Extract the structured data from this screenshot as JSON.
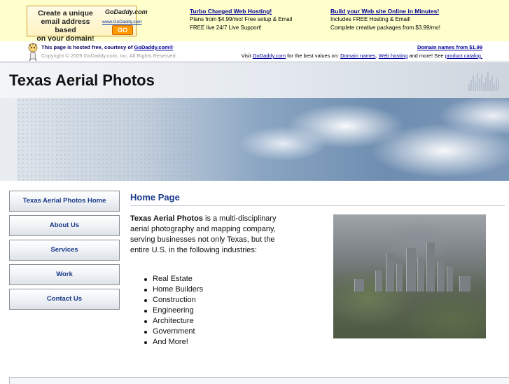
{
  "ad_banner": {
    "ad_box": {
      "text_lines": [
        "Create a unique",
        "email address based",
        "on your domain!"
      ],
      "brand": "GoDaddy.com",
      "url": "www.GoDaddy.com",
      "go_label": "GO"
    },
    "promos": [
      {
        "title": "Turbo Charged Web Hosting!",
        "lines": [
          "Plans from $4.99/mo! Free setup & Email",
          "FREE live 24/7 Live Support!"
        ]
      },
      {
        "title": "Build your Web site Online in Minutes!",
        "lines": [
          "Includes FREE Hosting & Email!",
          "Complete creative packages from $3.99/mo!"
        ]
      }
    ]
  },
  "hosting_bar": {
    "line1_prefix": "This page is hosted free, courtesy of ",
    "line1_link": "GoDaddy.com®",
    "line2": "Copyright © 2009 GoDaddy.com, Inc. All Rights Reserved.",
    "right_link": "Domain names from $1.99",
    "right2_prefix": "Visit ",
    "right2_link1": "GoDaddy.com",
    "right2_mid1": " for the best values on: ",
    "right2_link2": "Domain names",
    "right2_mid2": ", ",
    "right2_link3": "Web hosting",
    "right2_mid3": " and more! See ",
    "right2_link4": "product catalog."
  },
  "header": {
    "site_title": "Texas Aerial Photos"
  },
  "sidebar": {
    "items": [
      {
        "label": "Texas Aerial Photos Home"
      },
      {
        "label": "About Us"
      },
      {
        "label": "Services"
      },
      {
        "label": "Work"
      },
      {
        "label": "Contact Us"
      }
    ]
  },
  "content": {
    "heading": "Home Page",
    "intro_bold": "Texas Aerial Photos",
    "intro_rest": " is a multi-disciplinary aerial photography and mapping company, serving businesses not only Texas, but the entire U.S. in the following industries:",
    "industries": [
      "Real Estate",
      "Home Builders",
      "Construction",
      "Engineering",
      "Architecture",
      "Government",
      "And More!"
    ],
    "photo_alt": "aerial city photo"
  }
}
